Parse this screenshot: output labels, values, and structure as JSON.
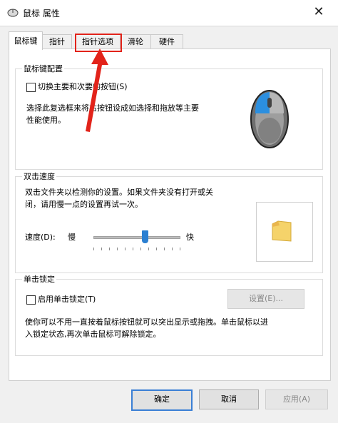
{
  "window": {
    "title": "鼠标 属性",
    "close_glyph": "✕"
  },
  "tabs": [
    {
      "label": "鼠标键",
      "active": true
    },
    {
      "label": "指针"
    },
    {
      "label": "指针选项",
      "highlighted": true
    },
    {
      "label": "滑轮"
    },
    {
      "label": "硬件"
    }
  ],
  "button_config": {
    "title": "鼠标键配置",
    "checkbox_label": "切换主要和次要的按钮(S)",
    "checked": false,
    "description_lines": [
      "选择此复选框来将右按钮设成如选择和拖放等主要",
      "性能使用。"
    ]
  },
  "double_click": {
    "title": "双击速度",
    "description_lines": [
      "双击文件夹以检测你的设置。如果文件夹没有打开或关",
      "闭，请用慢一点的设置再试一次。"
    ],
    "speed_label": "速度(D):",
    "slow_label": "慢",
    "fast_label": "快",
    "slider_fraction": 0.6
  },
  "click_lock": {
    "title": "单击锁定",
    "checkbox_label": "启用单击锁定(T)",
    "checked": false,
    "settings_button": "设置(E)...",
    "description_lines": [
      "使你可以不用一直按着鼠标按钮就可以突出显示或拖拽。单击鼠标以进",
      "入锁定状态,再次单击鼠标可解除锁定。"
    ]
  },
  "footer": {
    "ok": "确定",
    "cancel": "取消",
    "apply": "应用(A)"
  },
  "colors": {
    "highlight": "#e2231a",
    "accent": "#3a7fd5",
    "folder": "#f5d36a"
  }
}
